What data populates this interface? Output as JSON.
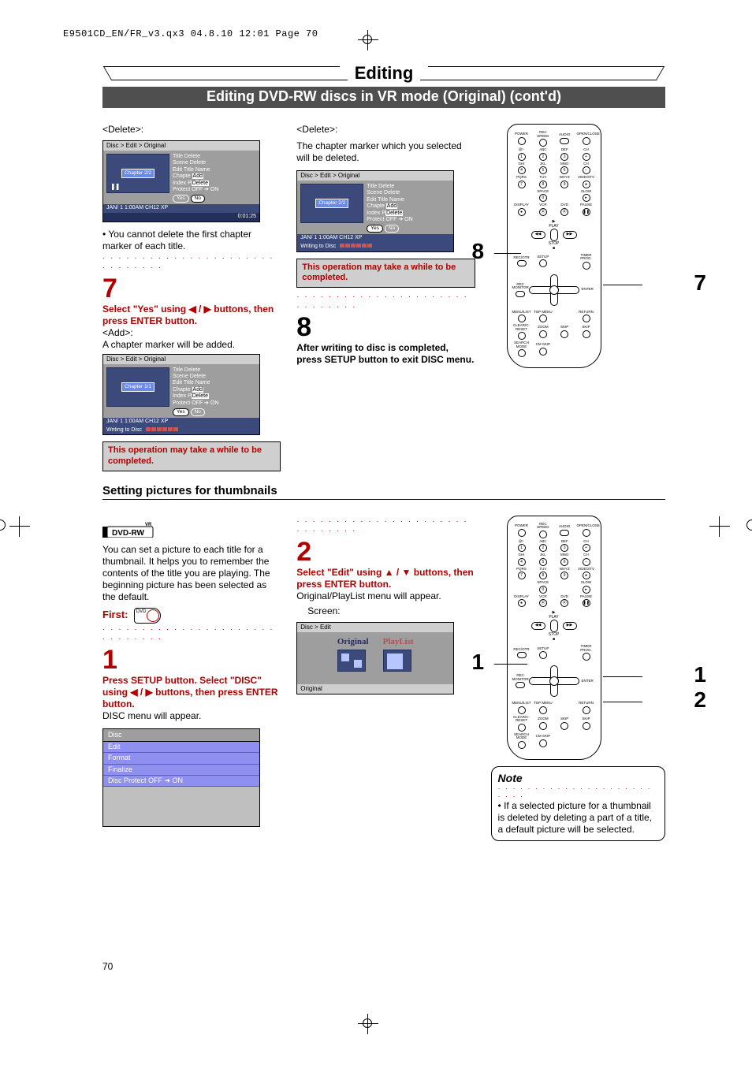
{
  "print_header": "E9501CD_EN/FR_v3.qx3  04.8.10  12:01  Page 70",
  "chapter_title": "Editing",
  "sub_title": "Editing DVD-RW discs in VR mode (Original) (cont'd)",
  "page_number": "70",
  "top": {
    "col1": {
      "delete_label": "<Delete>:",
      "osd1": {
        "crumb": "Disc > Edit > Original",
        "chapter": "Chapter 2/2",
        "menu": [
          "Title Delete",
          "Scene Delete",
          "Edit Title Name",
          "Chapter",
          "Index Picture",
          "Protect OFF"
        ],
        "overlay": [
          "Add",
          "Delete"
        ],
        "yes": "Yes",
        "no": "No",
        "sel": "no",
        "footer1": "JAN/ 1   1:00AM  CH12      XP",
        "footer2": "0:01:25"
      },
      "note1": "You cannot delete the first chapter marker of each title.",
      "step7_num": "7",
      "step7_text_a": "Select \"Yes\" using ",
      "step7_text_b": " buttons, then press ENTER button.",
      "add_label": "<Add>:",
      "add_text": "A chapter marker will be added.",
      "osd2": {
        "crumb": "Disc > Edit > Original",
        "chapter": "Chapter 1/1",
        "menu": [
          "Title Delete",
          "Scene Delete",
          "Edit Title Name",
          "Chapter",
          "Index Picture",
          "Protect OFF"
        ],
        "overlay": [
          "Add",
          "Delete"
        ],
        "yes": "Yes",
        "no": "No",
        "sel": "yes",
        "footer1": "JAN/ 1   1:00AM  CH12      XP",
        "footer_write": "Writing to Disc"
      },
      "warn": "This operation may take a while to be completed."
    },
    "col2": {
      "delete_label": "<Delete>:",
      "delete_text": "The chapter marker which you selected will be deleted.",
      "osd3": {
        "crumb": "Disc > Edit > Original",
        "chapter": "Chapter 2/2",
        "menu": [
          "Title Delete",
          "Scene Delete",
          "Edit Title Name",
          "Chapter",
          "Index Picture",
          "Protect OFF"
        ],
        "overlay": [
          "Add",
          "Delete"
        ],
        "yes": "Yes",
        "no": "No",
        "sel": "yes",
        "footer1": "JAN/ 1   1:00AM  CH12      XP",
        "footer_write": "Writing to Disc"
      },
      "warn": "This operation may take a while to be completed.",
      "step8_num": "8",
      "step8_text": "After writing to disc is completed, press SETUP button to exit DISC menu."
    },
    "remote_labels": {
      "c8": "8",
      "c7": "7"
    }
  },
  "section2_title": "Setting pictures for thumbnails",
  "bottom": {
    "col1": {
      "vr_label": "VR",
      "dvd_label": "DVD-RW",
      "intro": "You can set a picture to each title for a thumbnail. It helps you to remember the contents of the title you are playing. The beginning picture has been selected as the default.",
      "first": "First:",
      "disc_icon": "DVD",
      "step1_num": "1",
      "step1_text_a": "Press SETUP button. Select \"DISC\" using ",
      "step1_text_b": " buttons, then press ENTER button.",
      "step1_tail": "DISC menu will appear.",
      "disc_menu": {
        "title": "Disc",
        "rows": [
          "Edit",
          "Format",
          "Finalize",
          "Disc Protect OFF ➔ ON"
        ]
      }
    },
    "col2": {
      "step2_num": "2",
      "step2_text_a": "Select \"Edit\" using ",
      "step2_text_b": " buttons, then press ENTER button.",
      "step2_tail": "Original/PlayList menu will appear.",
      "screen_lbl": "Screen:",
      "osd": {
        "crumb": "Disc > Edit",
        "tab1": "Original",
        "tab2": "PlayList",
        "foot": "Original"
      }
    },
    "remote_labels": {
      "c1": "1",
      "c1b": "1",
      "c2": "2"
    },
    "note": {
      "title": "Note",
      "body": "If a selected picture for a thumbnail is deleted by deleting a part of a title, a default picture will be selected."
    }
  },
  "remote_layout": {
    "row1": [
      "POWER",
      "REC SPEED",
      "AUDIO",
      "OPEN/CLOSE"
    ],
    "keypad": [
      [
        "@!·",
        "ABC",
        "DEF",
        "CH"
      ],
      [
        "GHI",
        "JKL",
        "MNO",
        "CH"
      ],
      [
        "PQRS",
        "TUV",
        "WXYZ",
        "VIDEO/TV"
      ]
    ],
    "nums": [
      [
        "1",
        "2",
        "3",
        "+"
      ],
      [
        "4",
        "5",
        "6",
        "−"
      ],
      [
        "7",
        "8",
        "9",
        "●"
      ]
    ],
    "row5": [
      "",
      "SPACE",
      "",
      "SLOW"
    ],
    "row5b": [
      "",
      "0",
      "",
      "▸"
    ],
    "row6": [
      "DISPLAY",
      "VCR",
      "DVD",
      "PAUSE"
    ],
    "row6b": [
      "●",
      "⦿",
      "⦿",
      "❚❚"
    ],
    "dpad": {
      "play": "PLAY",
      "stop": "STOP"
    },
    "row8": [
      "REC/OTR",
      "SETUP",
      "",
      "TIMER PROG."
    ],
    "row9": [
      "REC MONITOR",
      "",
      "ENTER",
      ""
    ],
    "row10": [
      "MENU/LIST",
      "TOP MENU",
      "",
      "RETURN"
    ],
    "row11": [
      "CLEAR/C-RESET",
      "ZOOM",
      "SKIP",
      "SKIP"
    ],
    "row12": [
      "SEARCH MODE",
      "CM SKIP",
      "",
      ""
    ]
  }
}
